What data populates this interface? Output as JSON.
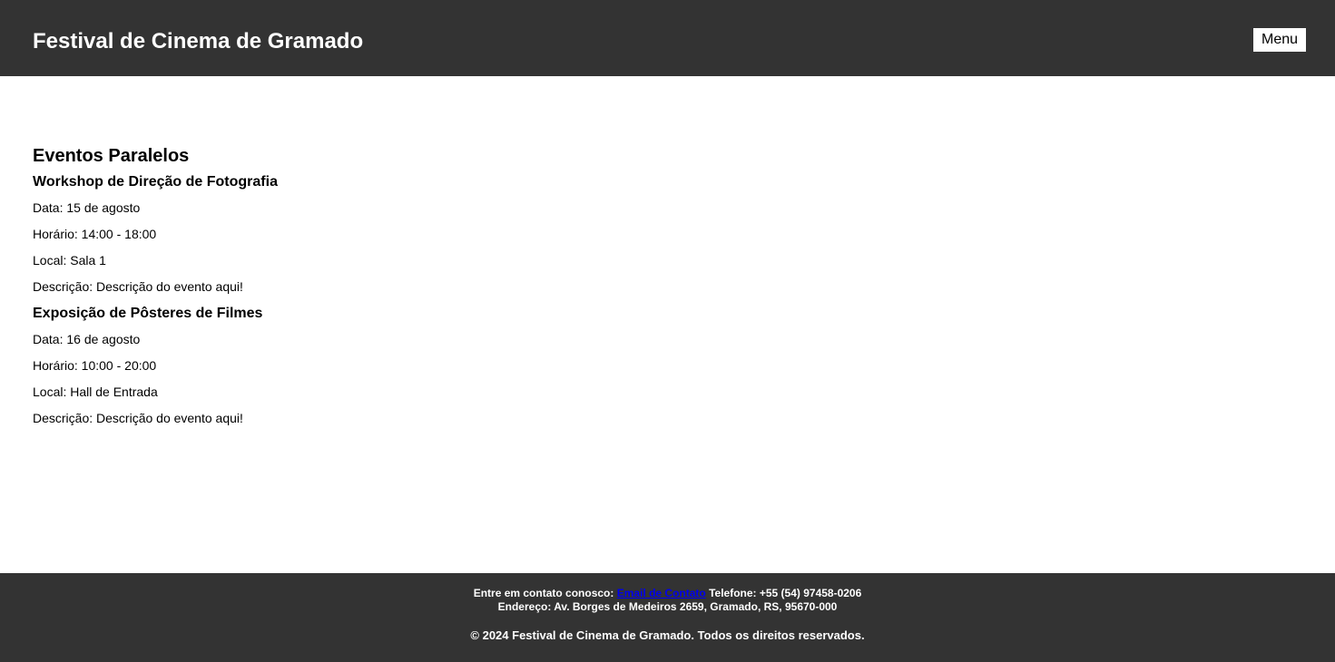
{
  "header": {
    "title": "Festival de Cinema de Gramado",
    "menu_label": "Menu"
  },
  "main": {
    "section_title": "Eventos Paralelos",
    "events": [
      {
        "title": "Workshop de Direção de Fotografia",
        "date": "Data: 15 de agosto",
        "time": "Horário: 14:00 - 18:00",
        "location": "Local: Sala 1",
        "description": "Descrição: Descrição do evento aqui!"
      },
      {
        "title": "Exposição de Pôsteres de Filmes",
        "date": "Data: 16 de agosto",
        "time": "Horário: 10:00 - 20:00",
        "location": "Local: Hall de Entrada",
        "description": "Descrição: Descrição do evento aqui!"
      }
    ]
  },
  "footer": {
    "contact_prefix": "Entre em contato conosco:",
    "contact_link": "Email de Contato",
    "phone": "Telefone: +55 (54) 97458-0206",
    "address": "Endereço: Av. Borges de Medeiros 2659, Gramado, RS, 95670-000",
    "copyright": "© 2024 Festival de Cinema de Gramado. Todos os direitos reservados."
  },
  "colors": {
    "header_bg": "#333333",
    "footer_bg": "#333333",
    "link": "#0000ee"
  }
}
